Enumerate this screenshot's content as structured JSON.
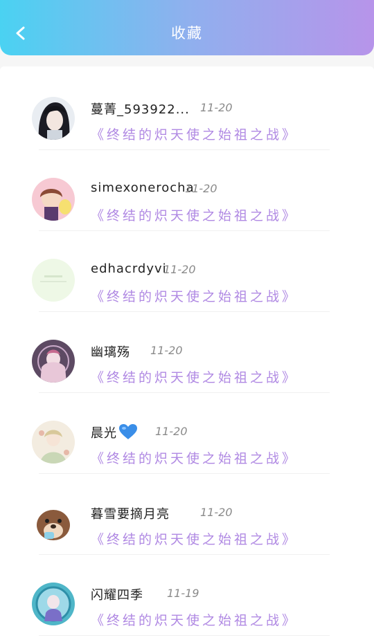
{
  "header": {
    "title": "收藏",
    "back_icon": "chevron-left-icon"
  },
  "colors": {
    "header_gradient_start": "#4ad2f2",
    "header_gradient_end": "#b794ea",
    "book_title": "#b089e3"
  },
  "favorites": [
    {
      "name": "蔓菁_593922...",
      "date": "11-20",
      "book": "《终结的炽天使之始祖之战》",
      "avatar": "avatar-dark-hair-boy"
    },
    {
      "name": "simexonerocha",
      "date": "11-20",
      "book": "《终结的炽天使之始祖之战》",
      "avatar": "avatar-pink-chibi"
    },
    {
      "name": "edhacrdyvi",
      "date": "11-20",
      "book": "《终结的炽天使之始祖之战》",
      "avatar": "avatar-default-green"
    },
    {
      "name": "幽璃殇",
      "date": "11-20",
      "book": "《终结的炽天使之始祖之战》",
      "avatar": "avatar-purple-anime"
    },
    {
      "name": "晨光",
      "date": "11-20",
      "book": "《终结的炽天使之始祖之战》",
      "avatar": "avatar-floral-anime",
      "name_icon": "blue-heart-icon"
    },
    {
      "name": "暮雪要摘月亮",
      "date": "11-20",
      "book": "《终结的炽天使之始祖之战》",
      "avatar": "avatar-otter"
    },
    {
      "name": "闪耀四季",
      "date": "11-19",
      "book": "《终结的炽天使之始祖之战》",
      "avatar": "avatar-blue-circle"
    }
  ]
}
